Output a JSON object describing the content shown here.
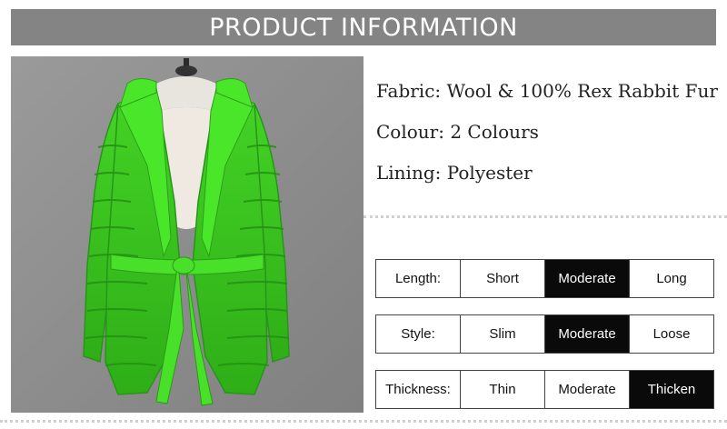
{
  "header": {
    "title": "PRODUCT INFORMATION"
  },
  "specs": {
    "fabric": "Fabric: Wool & 100% Rex Rabbit Fur",
    "colour": "Colour: 2 Colours",
    "lining": "Lining: Polyester"
  },
  "size_chart": [
    {
      "label": "Length:",
      "options": [
        "Short",
        "Moderate",
        "Long"
      ],
      "selected": "Moderate"
    },
    {
      "label": "Style:",
      "options": [
        "Slim",
        "Moderate",
        "Loose"
      ],
      "selected": "Moderate"
    },
    {
      "label": "Thickness:",
      "options": [
        "Thin",
        "Moderate",
        "Thicken"
      ],
      "selected": "Thicken"
    }
  ],
  "colors": {
    "header_bg": "#848484",
    "fur_green": "#3ec71f",
    "selected_bg": "#0a0a0a"
  }
}
